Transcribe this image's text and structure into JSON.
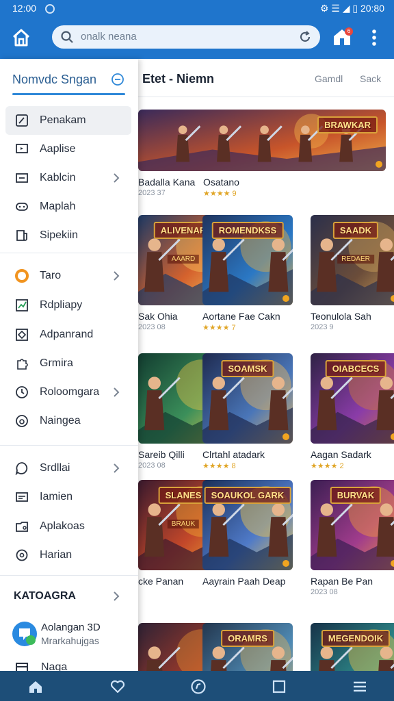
{
  "status": {
    "time": "12:00",
    "right": "⚙ ☰ ◢ ▯ 20:80"
  },
  "appbar": {
    "search_placeholder": "onalk neana",
    "badge": "6"
  },
  "drawer": {
    "title": "Nomvdc Sngan",
    "items": [
      {
        "label": "Penakam",
        "icon": "edit-icon",
        "active": true
      },
      {
        "label": "Aaplise",
        "icon": "tv-icon"
      },
      {
        "label": "Kablcin",
        "icon": "category-icon",
        "chevron": true
      },
      {
        "label": "Maplah",
        "icon": "gamepad-icon"
      },
      {
        "label": "Sipekiin",
        "icon": "news-icon"
      },
      {
        "label": "Taro",
        "icon": "orange-circle-icon",
        "chevron": true
      },
      {
        "label": "Rdpliapy",
        "icon": "chart-icon"
      },
      {
        "label": "Adpanrand",
        "icon": "diamond-icon"
      },
      {
        "label": "Grmira",
        "icon": "puzzle-icon"
      },
      {
        "label": "Roloomgara",
        "icon": "clock-icon",
        "chevron": true
      },
      {
        "label": "Naingea",
        "icon": "headset-icon"
      },
      {
        "label": "Srdllai",
        "icon": "chat-icon",
        "chevron": true
      },
      {
        "label": "Iamien",
        "icon": "card-icon"
      },
      {
        "label": "Aplakoas",
        "icon": "folder-icon"
      },
      {
        "label": "Harian",
        "icon": "settings-icon"
      }
    ],
    "section": "KATOAGRA",
    "promo": {
      "title": "Aolangan 3D",
      "subtitle": "Mrarkahujgas"
    },
    "last": "Naga"
  },
  "main": {
    "title": "Etet - Niemn",
    "tabs": [
      "Gamdl",
      "Sack"
    ],
    "featured": [
      {
        "title": "Badalla Kana",
        "meta": "2023 37",
        "banner": ""
      },
      {
        "title": "Osatano",
        "meta": "★★★★ 9",
        "banner": "BRAWKAR"
      }
    ],
    "grid": [
      {
        "title": "Sak Ohia",
        "meta": "2023 08",
        "banner": "ALIVENAR",
        "sub": "AAARD"
      },
      {
        "title": "Aortane Fae Cakn",
        "meta": "★★★★ 7",
        "banner": "ROMENDKSS",
        "sub": ""
      },
      {
        "title": "Teonulola Sah",
        "meta": "2023 9",
        "banner": "SAADK",
        "sub": "REDAER"
      },
      {
        "title": "Sareib Qilli",
        "meta": "2023 08",
        "banner": "",
        "sub": ""
      },
      {
        "title": "Clrtahl atadark",
        "meta": "★★★★ 8",
        "banner": "SOAMSK",
        "sub": ""
      },
      {
        "title": "Aagan Sadark",
        "meta": "★★★★ 2",
        "banner": "OIABCECS",
        "sub": ""
      },
      {
        "title": "cke Panan",
        "meta": "",
        "banner": "SLANES",
        "sub": "BRAUK"
      },
      {
        "title": "Aayrain Paah Deap",
        "meta": "",
        "banner": "SOAUKOL GARK",
        "sub": ""
      },
      {
        "title": "Rapan Be Pan",
        "meta": "2023 08",
        "banner": "BURVAK",
        "sub": ""
      },
      {
        "title": "",
        "meta": "",
        "banner": "",
        "sub": ""
      },
      {
        "title": "",
        "meta": "",
        "banner": "ORAMRS",
        "sub": ""
      },
      {
        "title": "",
        "meta": "",
        "banner": "MEGENDOIK",
        "sub": ""
      }
    ]
  },
  "bottomnav": [
    "home-icon",
    "heart-icon",
    "compass-icon",
    "square-icon",
    "menu-icon"
  ]
}
